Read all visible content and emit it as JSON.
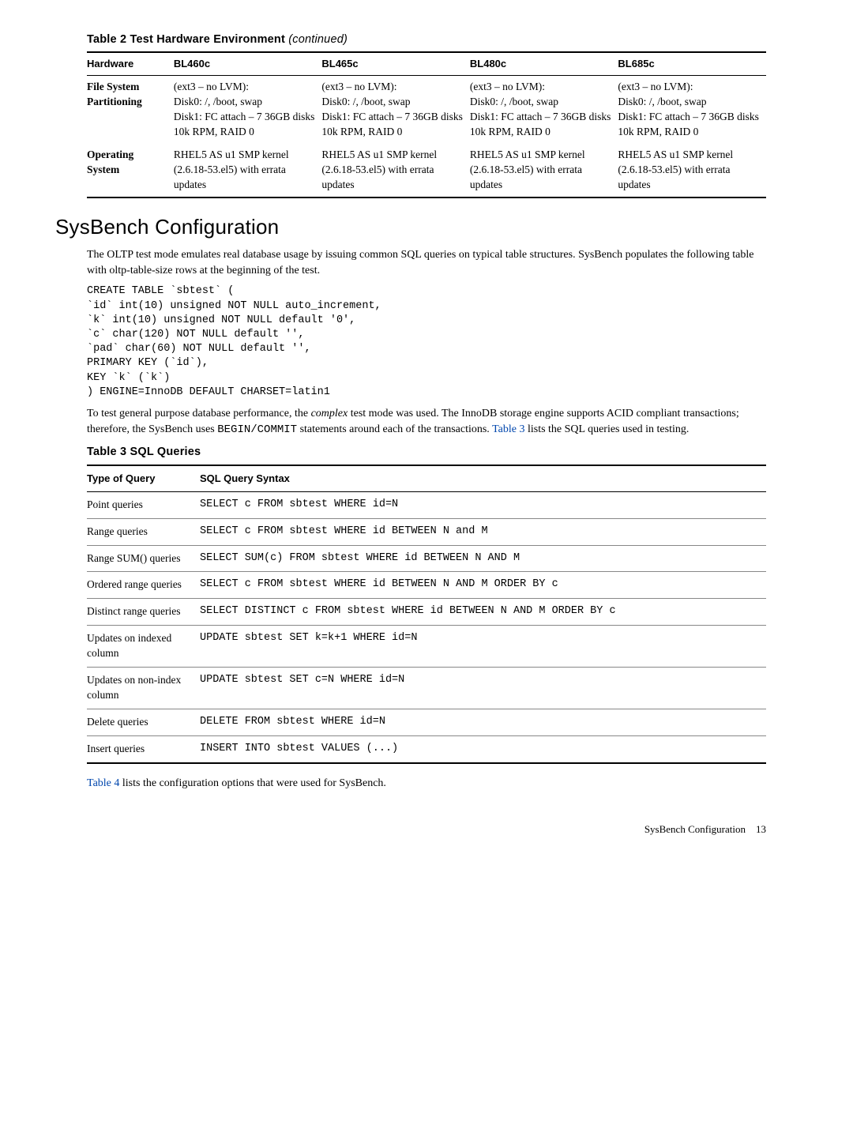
{
  "table2": {
    "caption_prefix": "Table 2 Test Hardware Environment",
    "caption_suffix": "(continued)",
    "headers": [
      "Hardware",
      "BL460c",
      "BL465c",
      "BL480c",
      "BL685c"
    ],
    "rows": [
      {
        "label": "File System Partitioning",
        "cells": [
          "(ext3 – no LVM):\nDisk0: /, /boot, swap\nDisk1: FC attach – 7 36GB disks 10k RPM, RAID 0",
          "(ext3 – no LVM):\nDisk0: /, /boot, swap\nDisk1: FC attach – 7 36GB disks 10k RPM, RAID 0",
          "(ext3 – no LVM):\nDisk0: /, /boot, swap\nDisk1: FC attach – 7 36GB disks 10k RPM, RAID 0",
          "(ext3 – no LVM):\nDisk0: /, /boot, swap\nDisk1: FC attach – 7 36GB disks 10k RPM, RAID 0"
        ]
      },
      {
        "label": "Operating System",
        "cells": [
          "RHEL5 AS u1 SMP kernel (2.6.18-53.el5) with errata updates",
          "RHEL5 AS u1 SMP kernel (2.6.18-53.el5) with errata updates",
          "RHEL5 AS u1 SMP kernel (2.6.18-53.el5) with errata updates",
          "RHEL5 AS u1 SMP kernel (2.6.18-53.el5) with errata updates"
        ]
      }
    ]
  },
  "section_title": "SysBench Configuration",
  "para1": "The OLTP test mode emulates real database usage by issuing common SQL queries on typical table structures. SysBench populates the following table with oltp-table-size rows at the beginning of the test.",
  "codeblock": "CREATE TABLE `sbtest` (\n`id` int(10) unsigned NOT NULL auto_increment,\n`k` int(10) unsigned NOT NULL default '0',\n`c` char(120) NOT NULL default '',\n`pad` char(60) NOT NULL default '',\nPRIMARY KEY (`id`),\nKEY `k` (`k`)\n) ENGINE=InnoDB DEFAULT CHARSET=latin1",
  "para2_a": "To test general purpose database performance, the ",
  "para2_em": "complex",
  "para2_b": " test mode was used. The InnoDB storage engine supports ACID compliant transactions; therefore, the SysBench uses ",
  "para2_mono": "BEGIN/COMMIT",
  "para2_c": " statements around each of the transactions. ",
  "para2_link": "Table 3",
  "para2_d": " lists the SQL queries used in testing.",
  "table3": {
    "caption": "Table 3 SQL Queries",
    "headers": [
      "Type of Query",
      "SQL Query Syntax"
    ],
    "rows": [
      {
        "type": "Point queries",
        "sql": "SELECT c FROM sbtest WHERE id=N"
      },
      {
        "type": "Range queries",
        "sql": "SELECT c FROM sbtest WHERE id BETWEEN N and M"
      },
      {
        "type": "Range SUM() queries",
        "sql": "SELECT SUM(c) FROM sbtest WHERE id BETWEEN N AND M"
      },
      {
        "type": "Ordered range queries",
        "sql": "SELECT c FROM sbtest WHERE id BETWEEN N AND M ORDER BY c"
      },
      {
        "type": "Distinct range queries",
        "sql": "SELECT DISTINCT c FROM sbtest WHERE id BETWEEN N AND M ORDER BY c"
      },
      {
        "type": "Updates on indexed column",
        "sql": "UPDATE sbtest SET k=k+1 WHERE id=N"
      },
      {
        "type": "Updates on non-index column",
        "sql": "UPDATE sbtest SET c=N WHERE id=N"
      },
      {
        "type": "Delete queries",
        "sql": "DELETE FROM sbtest WHERE id=N"
      },
      {
        "type": "Insert queries",
        "sql": "INSERT INTO sbtest VALUES (...)"
      }
    ]
  },
  "para3_link": "Table 4",
  "para3_rest": " lists the configuration options that were used for SysBench.",
  "footer_label": "SysBench Configuration",
  "footer_page": "13"
}
